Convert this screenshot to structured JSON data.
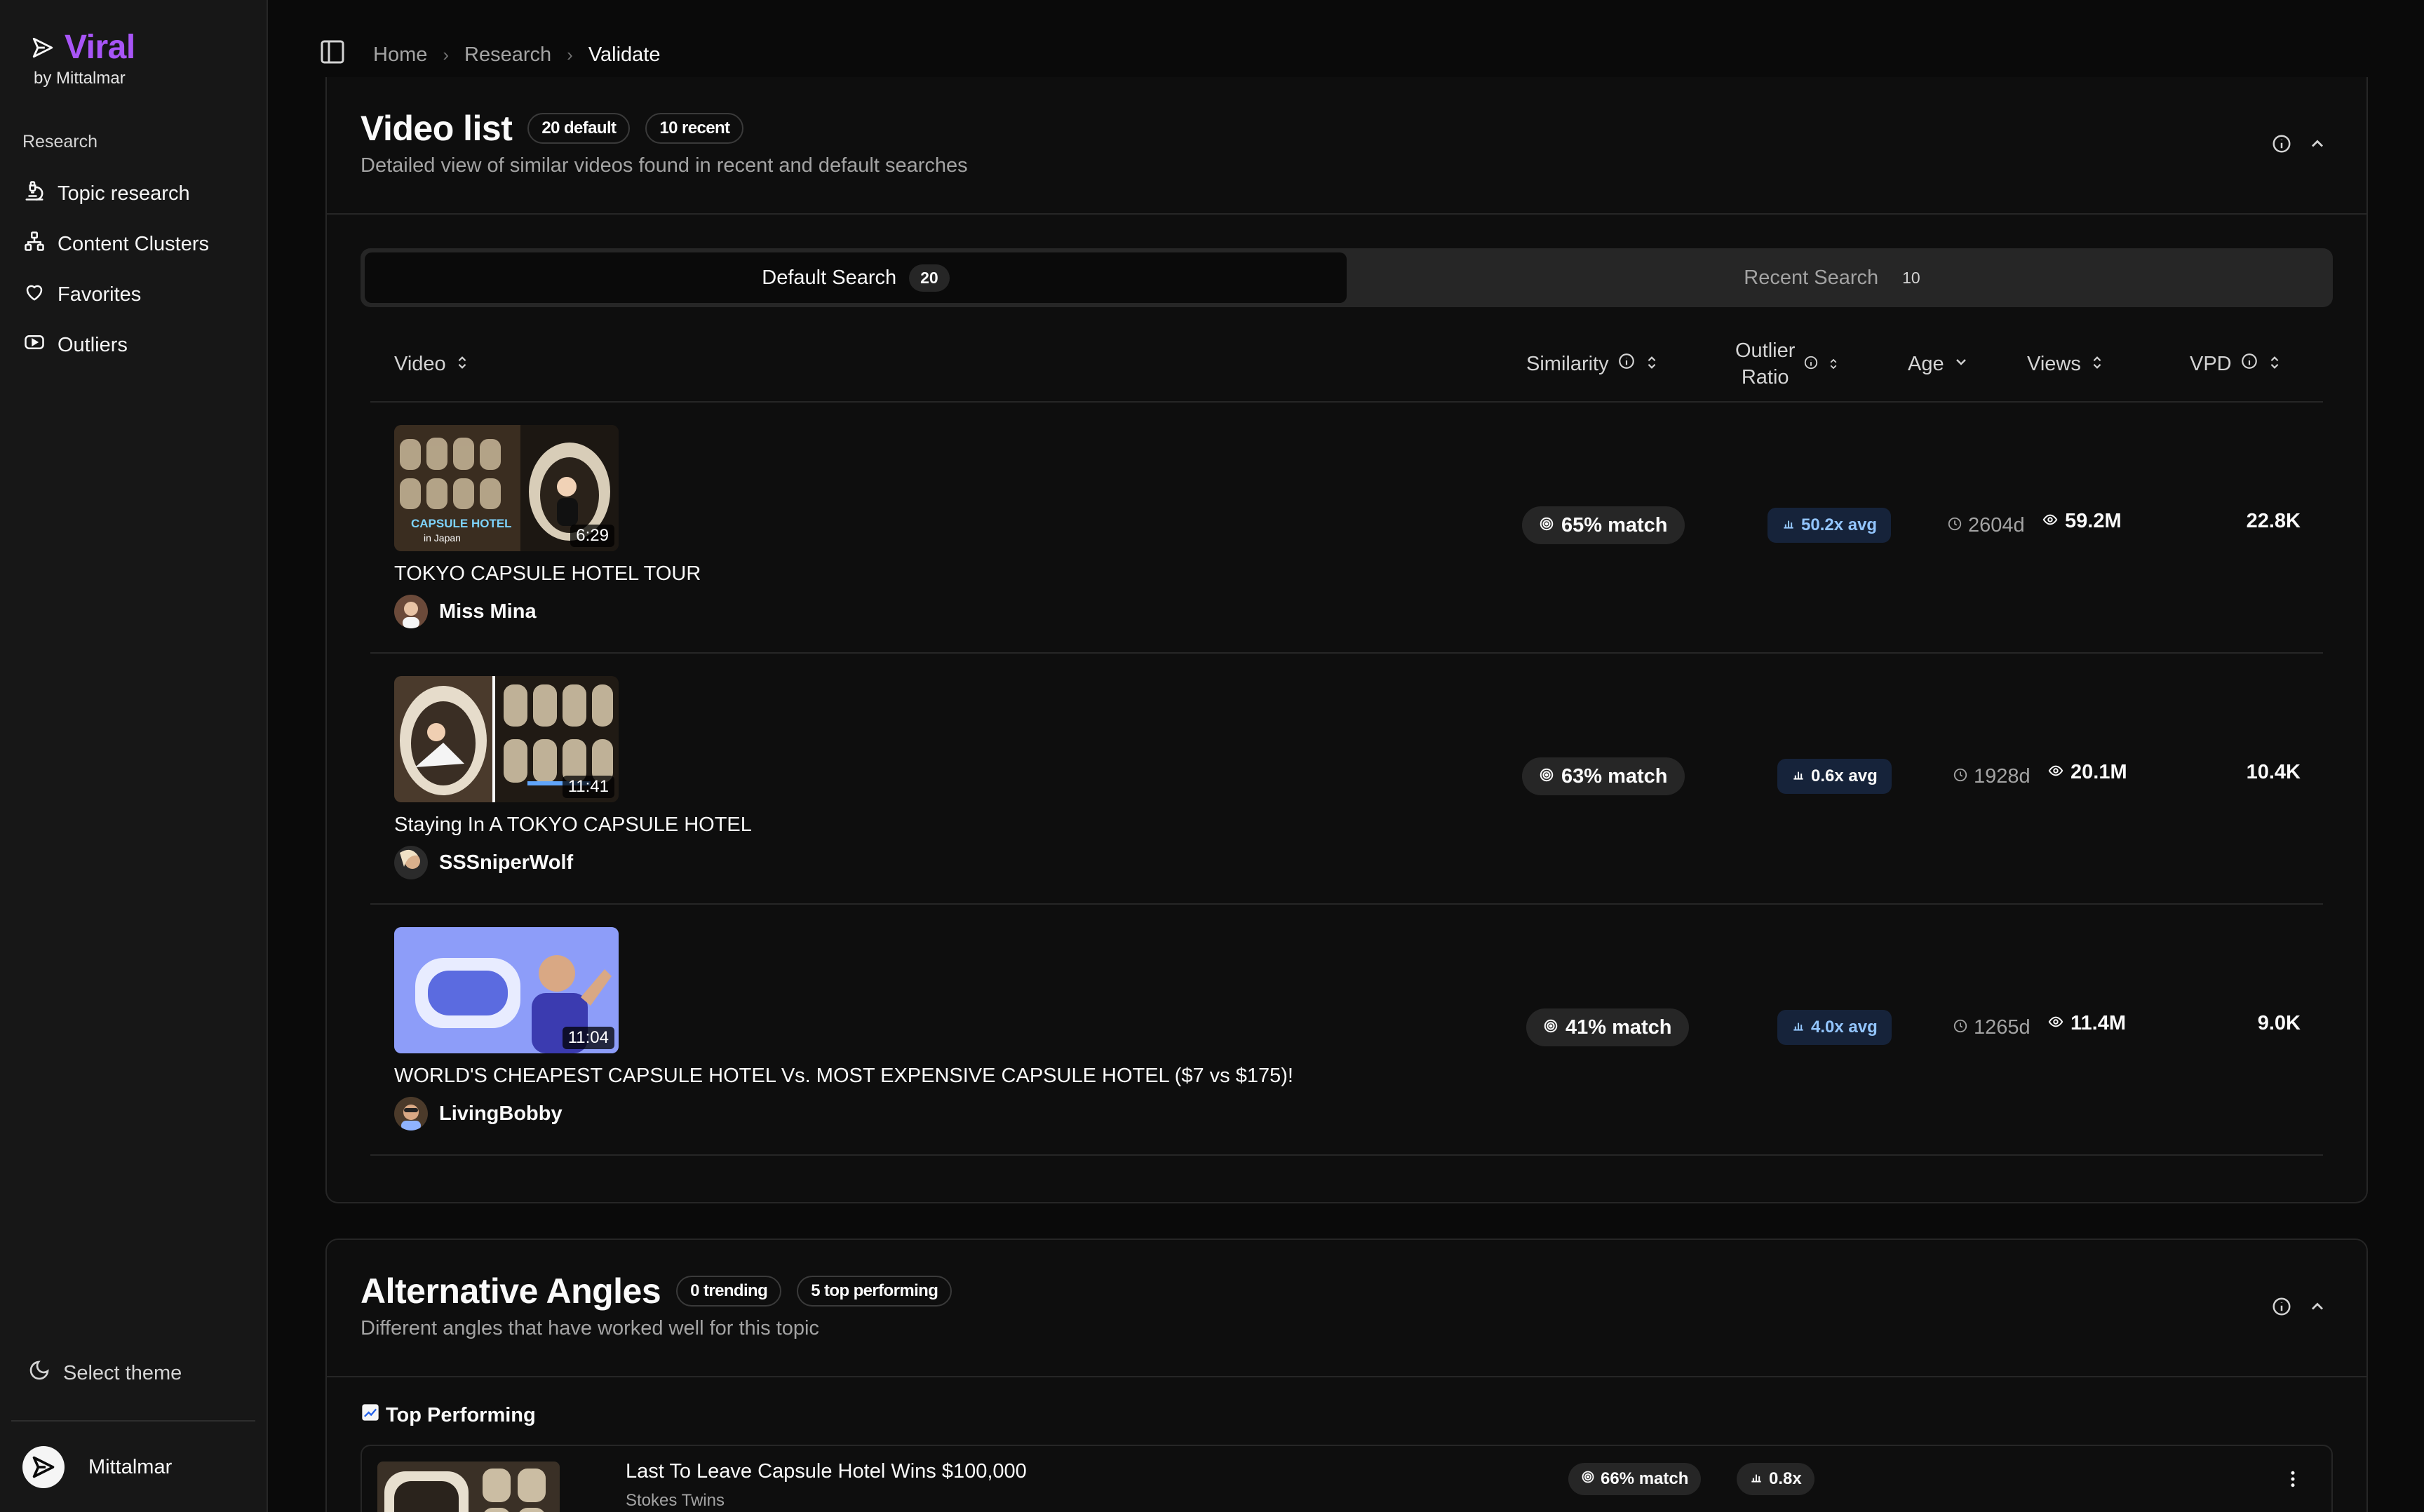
{
  "brand": {
    "name": "Viral",
    "byline": "by Mittalmar"
  },
  "sidebar": {
    "group_label": "Research",
    "items": [
      {
        "label": "Topic research",
        "icon": "microscope-icon"
      },
      {
        "label": "Content Clusters",
        "icon": "network-icon"
      },
      {
        "label": "Favorites",
        "icon": "heart-icon"
      },
      {
        "label": "Outliers",
        "icon": "youtube-icon"
      }
    ],
    "theme_label": "Select theme",
    "user_name": "Mittalmar"
  },
  "breadcrumb": {
    "items": [
      "Home",
      "Research"
    ],
    "current": "Validate"
  },
  "video_list": {
    "title": "Video list",
    "badges": [
      "20 default",
      "10 recent"
    ],
    "subtitle": "Detailed view of similar videos found in recent and default searches",
    "tabs": [
      {
        "label": "Default Search",
        "count": "20",
        "active": true
      },
      {
        "label": "Recent Search",
        "count": "10",
        "active": false
      }
    ],
    "columns": {
      "video": "Video",
      "similarity": "Similarity",
      "outlier_line1": "Outlier",
      "outlier_line2": "Ratio",
      "age": "Age",
      "views": "Views",
      "vpd": "VPD"
    },
    "rows": [
      {
        "duration": "6:29",
        "thumb_text_1": "CAPSULE HOTEL",
        "thumb_text_2": "in Japan",
        "title": "TOKYO CAPSULE HOTEL TOUR",
        "channel": "Miss Mina",
        "similarity": "65% match",
        "outlier": "50.2x avg",
        "age": "2604d",
        "views": "59.2M",
        "vpd": "22.8K"
      },
      {
        "duration": "11:41",
        "title": "Staying In A TOKYO CAPSULE HOTEL",
        "channel": "SSSniperWolf",
        "similarity": "63% match",
        "outlier": "0.6x avg",
        "age": "1928d",
        "views": "20.1M",
        "vpd": "10.4K"
      },
      {
        "duration": "11:04",
        "title": "WORLD'S CHEAPEST CAPSULE HOTEL Vs. MOST EXPENSIVE CAPSULE HOTEL ($7 vs $175)!",
        "channel": "LivingBobby",
        "similarity": "41% match",
        "outlier": "4.0x avg",
        "age": "1265d",
        "views": "11.4M",
        "vpd": "9.0K"
      }
    ]
  },
  "alternative_angles": {
    "title": "Alternative Angles",
    "badges": [
      "0 trending",
      "5 top performing"
    ],
    "subtitle": "Different angles that have worked well for this topic",
    "section_label": "Top Performing",
    "items": [
      {
        "title": "Last To Leave Capsule Hotel Wins $100,000",
        "channel": "Stokes Twins",
        "similarity": "66% match",
        "outlier": "0.8x"
      }
    ]
  },
  "colors": {
    "accent": "#a855f7",
    "outlier_text": "#93c5fd",
    "background": "#0a0a0a"
  }
}
